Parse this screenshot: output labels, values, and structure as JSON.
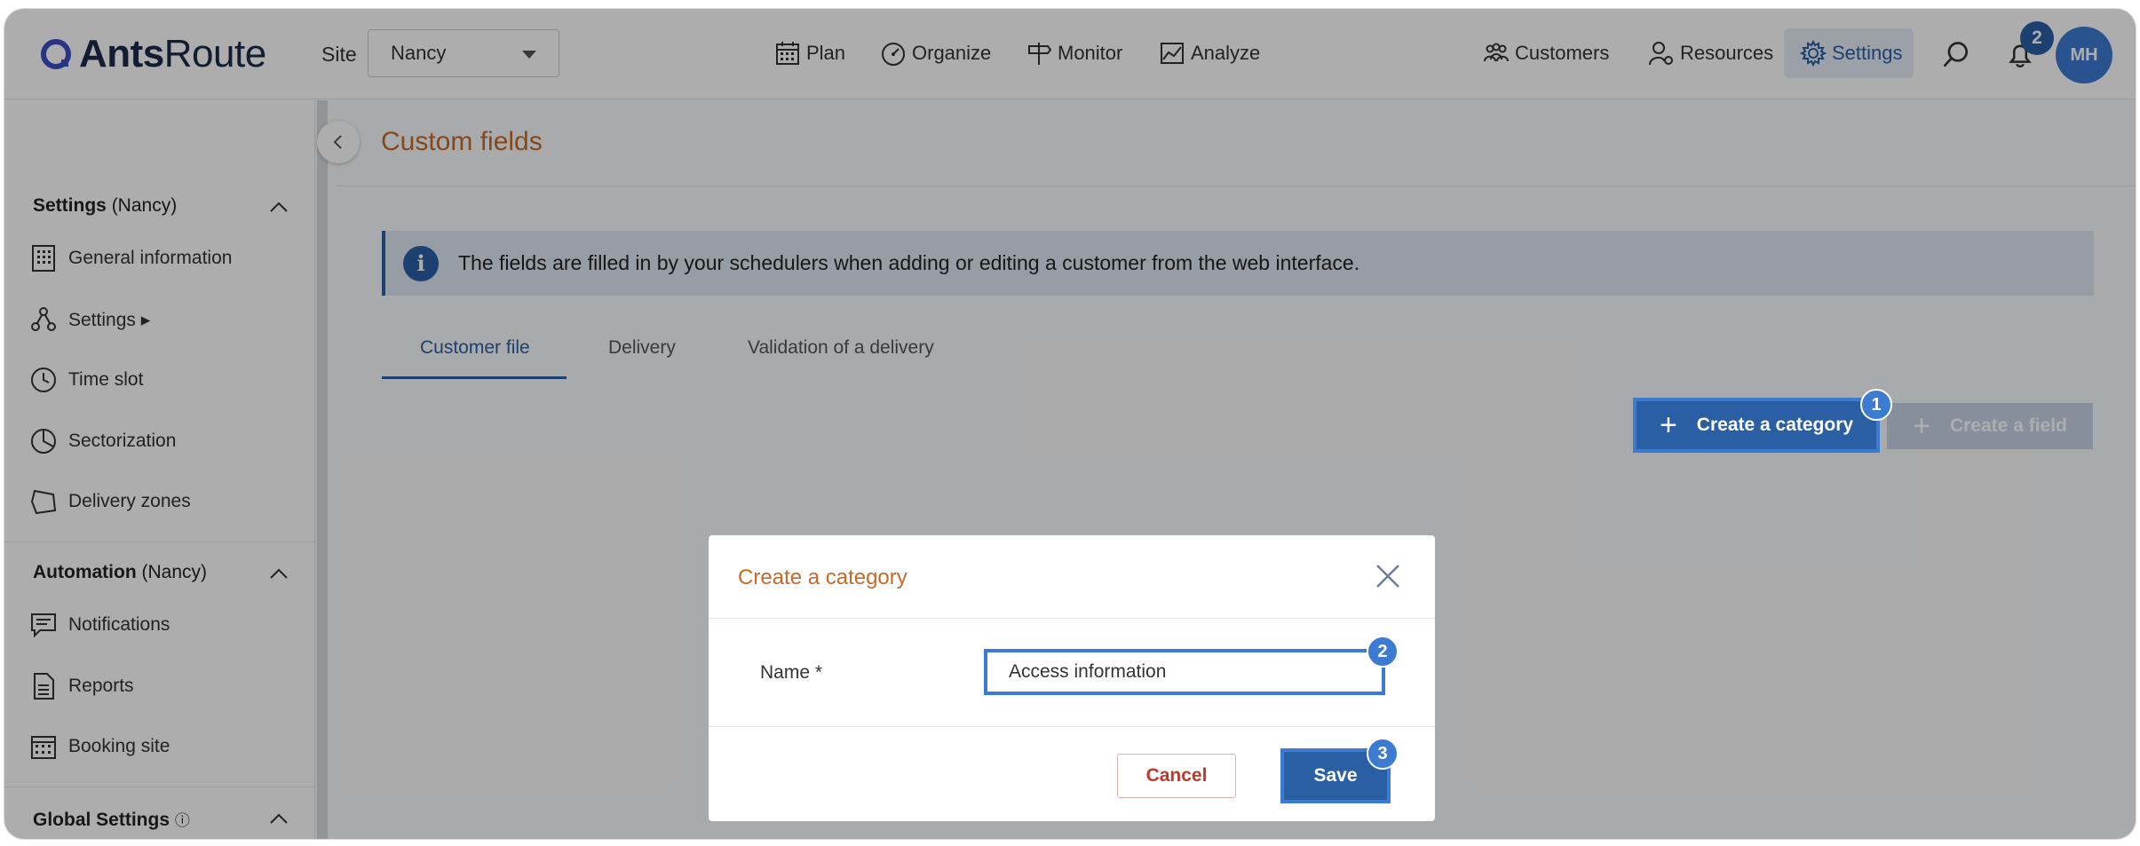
{
  "app": {
    "logo_text_bold": "Ants",
    "logo_text_light": "Route"
  },
  "header": {
    "site_label": "Site",
    "site_value": "Nancy",
    "nav": [
      {
        "label": "Plan",
        "icon": "calendar-icon"
      },
      {
        "label": "Organize",
        "icon": "gauge-icon"
      },
      {
        "label": "Monitor",
        "icon": "signpost-icon"
      },
      {
        "label": "Analyze",
        "icon": "chart-icon"
      }
    ],
    "right_nav": [
      {
        "label": "Customers",
        "icon": "customers-icon"
      },
      {
        "label": "Resources",
        "icon": "resources-icon"
      },
      {
        "label": "Settings",
        "icon": "gear-icon"
      }
    ],
    "notifications_count": "2",
    "avatar_initials": "MH"
  },
  "sidebar": {
    "section1": {
      "title": "Settings",
      "sub": "(Nancy)"
    },
    "items1": [
      {
        "label": "General information"
      },
      {
        "label": "Settings ▸"
      },
      {
        "label": "Time slot"
      },
      {
        "label": "Sectorization"
      },
      {
        "label": "Delivery zones"
      }
    ],
    "section2": {
      "title": "Automation",
      "sub": "(Nancy)"
    },
    "items2": [
      {
        "label": "Notifications"
      },
      {
        "label": "Reports"
      },
      {
        "label": "Booking site"
      }
    ],
    "section3": {
      "title": "Global Settings",
      "info": "ⓘ"
    }
  },
  "main": {
    "title": "Custom fields",
    "info_text": "The fields are filled in by your schedulers when adding or editing a customer from the web interface.",
    "tabs": [
      {
        "label": "Customer file"
      },
      {
        "label": "Delivery"
      },
      {
        "label": "Validation of a delivery"
      }
    ],
    "create_category_label": "Create a category",
    "create_field_label": "Create a field"
  },
  "modal": {
    "title": "Create a category",
    "name_label": "Name *",
    "name_value": "Access information",
    "cancel_label": "Cancel",
    "save_label": "Save"
  },
  "steps": [
    "1",
    "2",
    "3"
  ],
  "colors": {
    "accent": "#2a5fa4",
    "highlight": "#3b7bd1",
    "title_orange": "#c46a2b",
    "danger": "#c0392b"
  }
}
